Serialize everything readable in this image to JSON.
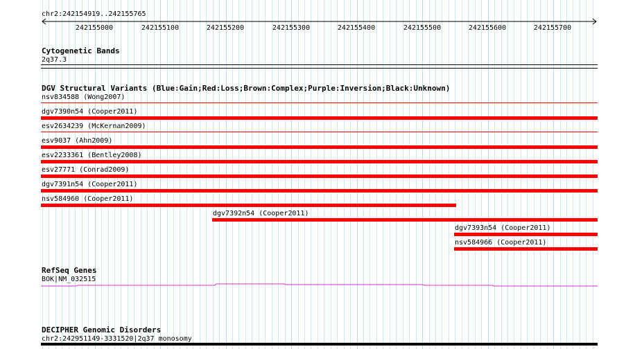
{
  "ruler": {
    "range_label": "chr2:242154919..242155765",
    "ticks": [
      "242155000",
      "242155100",
      "242155200",
      "242155300",
      "242155400",
      "242155500",
      "242155600",
      "242155700"
    ]
  },
  "cytoband": {
    "title": "Cytogenetic Bands",
    "label": "2q37.3"
  },
  "dgv": {
    "title": "DGV Structural Variants (Blue:Gain;Red:Loss;Brown:Complex;Purple:Inversion;Black:Unknown)",
    "features": [
      {
        "label": "nsv834588 (Wong2007)",
        "type": "thin"
      },
      {
        "label": "dgv7390n54 (Cooper2011)",
        "type": "thick"
      },
      {
        "label": "esv2634239 (McKernan2009)",
        "type": "thin"
      },
      {
        "label": "esv9037 (Ahn2009)",
        "type": "thick"
      },
      {
        "label": "esv2233361 (Bentley2008)",
        "type": "thick"
      },
      {
        "label": "esv27771 (Conrad2009)",
        "type": "thick"
      },
      {
        "label": "dgv7391n54 (Cooper2011)",
        "type": "thick"
      },
      {
        "label": "nsv584960 (Cooper2011)",
        "type": "thick"
      },
      {
        "label": "dgv7392n54 (Cooper2011)",
        "type": "thick"
      },
      {
        "label": "dgv7393n54 (Cooper2011)",
        "type": "thick"
      },
      {
        "label": "nsv584966 (Cooper2011)",
        "type": "thick"
      }
    ],
    "color": "#ff0000"
  },
  "refseq": {
    "title": "RefSeq Genes",
    "label": "BOK|NM_032515",
    "color": "#cc33cc"
  },
  "decipher": {
    "title": "DECIPHER Genomic Disorders",
    "label": "chr2:242951149-3331520|2q37 monosomy"
  }
}
